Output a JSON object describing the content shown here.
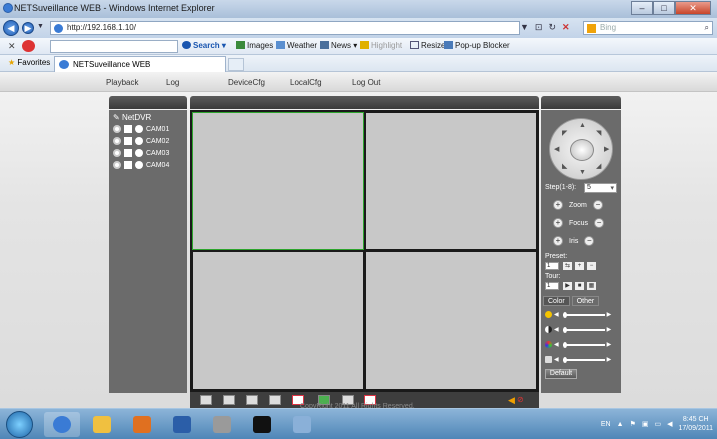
{
  "window": {
    "title": "NETSuveillance WEB - Windows Internet Explorer"
  },
  "address": {
    "url": "http://192.168.1.10/",
    "bing_placeholder": "Bing"
  },
  "toolbar": {
    "search": "Search",
    "images": "Images",
    "weather": "Weather",
    "news": "News",
    "highlight": "Highlight",
    "resize": "Resize",
    "popup": "Pop-up Blocker"
  },
  "favorites": {
    "label": "Favorites",
    "tab_title": "NETSuveillance WEB"
  },
  "menu": [
    {
      "label": "Playback"
    },
    {
      "label": "Log"
    },
    {
      "label": "DeviceCfg"
    },
    {
      "label": "LocalCfg"
    },
    {
      "label": "Log Out"
    }
  ],
  "left": {
    "root": "NetDVR",
    "cams": [
      "CAM01",
      "CAM02",
      "CAM03",
      "CAM04"
    ]
  },
  "right": {
    "step_label": "Step(1-8):",
    "step_value": "5",
    "zoom": "Zoom",
    "focus": "Focus",
    "iris": "Iris",
    "preset_label": "Preset:",
    "preset_value": "1",
    "tour_label": "Tour:",
    "tour_value": "1",
    "tab_color": "Color",
    "tab_other": "Other",
    "default": "Default"
  },
  "footer": {
    "copyright": "CopyRight 2011 All Rights Reserved."
  },
  "tray": {
    "lang": "EN",
    "time": "8:45 CH",
    "date": "17/09/2011"
  },
  "colors": {
    "selection": "#2da52d",
    "panel": "#6b6b6b",
    "header": "#3a3a3a"
  }
}
